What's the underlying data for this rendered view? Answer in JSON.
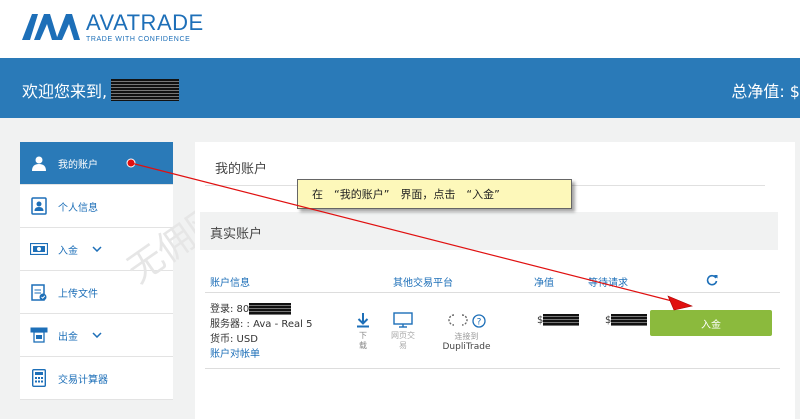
{
  "brand": {
    "name": "AVATRADE",
    "tagline": "TRADE WITH CONFIDENCE",
    "color": "#1d6fb8"
  },
  "banner": {
    "welcome": "欢迎您来到,",
    "net_label": "总净值: $"
  },
  "sidebar": {
    "items": [
      {
        "label": "我的账户",
        "icon": "user-icon",
        "active": true
      },
      {
        "label": "个人信息",
        "icon": "id-card-icon"
      },
      {
        "label": "入金",
        "icon": "cash-icon",
        "chevron": "⌄"
      },
      {
        "label": "上传文件",
        "icon": "upload-doc-icon"
      },
      {
        "label": "出金",
        "icon": "atm-icon",
        "chevron": "⌄"
      },
      {
        "label": "交易计算器",
        "icon": "calculator-icon"
      }
    ]
  },
  "main": {
    "title": "我的账户",
    "section": "真实账户",
    "columns": {
      "account_info": "账户信息",
      "other_platforms": "其他交易平台",
      "net_value": "净值",
      "pending": "等待请求"
    },
    "account": {
      "login_label": "登录: 80",
      "server": "服务器: : Ava - Real 5",
      "currency": "货币: USD",
      "statement_link": "账户对帐单"
    },
    "download": {
      "label_1": "下",
      "label_2": "载"
    },
    "web": {
      "label_1": "网页交",
      "label_2": "易"
    },
    "dupli": {
      "status": "连接到",
      "name": "DupliTrade"
    },
    "net_prefix": "$",
    "pending_prefix": "$",
    "deposit_button": "入金"
  },
  "annotation": {
    "text": "在　“我的账户”　界面，点击　“入金”"
  },
  "watermark": "无佣网",
  "colors": {
    "banner": "#2a7ab8",
    "button": "#8bba3d",
    "arrow": "#e01010",
    "callout": "#fdf8ba"
  }
}
